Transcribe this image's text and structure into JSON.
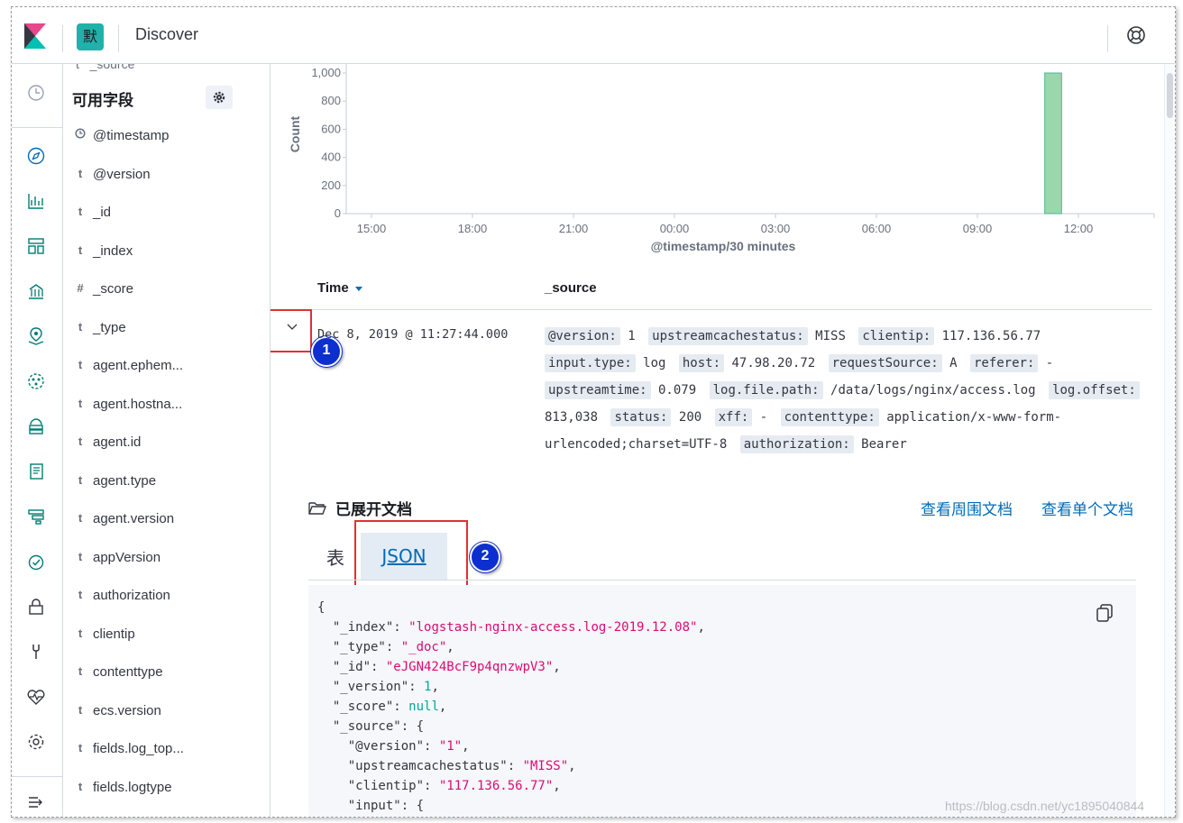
{
  "header": {
    "space_initial": "默",
    "app_title": "Discover"
  },
  "fields": {
    "cut_label": "_source",
    "title": "可用字段",
    "items": [
      {
        "type": "clock",
        "name": "@timestamp"
      },
      {
        "type": "t",
        "name": "@version"
      },
      {
        "type": "t",
        "name": "_id"
      },
      {
        "type": "t",
        "name": "_index"
      },
      {
        "type": "#",
        "name": "_score"
      },
      {
        "type": "t",
        "name": "_type"
      },
      {
        "type": "t",
        "name": "agent.ephem..."
      },
      {
        "type": "t",
        "name": "agent.hostna..."
      },
      {
        "type": "t",
        "name": "agent.id"
      },
      {
        "type": "t",
        "name": "agent.type"
      },
      {
        "type": "t",
        "name": "agent.version"
      },
      {
        "type": "t",
        "name": "appVersion"
      },
      {
        "type": "t",
        "name": "authorization"
      },
      {
        "type": "t",
        "name": "clientip"
      },
      {
        "type": "t",
        "name": "contenttype"
      },
      {
        "type": "t",
        "name": "ecs.version"
      },
      {
        "type": "t",
        "name": "fields.log_top..."
      },
      {
        "type": "t",
        "name": "fields.logtype"
      }
    ]
  },
  "chart_data": {
    "type": "bar",
    "title": "",
    "xlabel": "@timestamp/30 minutes",
    "ylabel": "Count",
    "ylim": [
      0,
      1000
    ],
    "yticks": [
      "0",
      "200",
      "400",
      "600",
      "800",
      "1,000"
    ],
    "xticks": [
      "15:00",
      "18:00",
      "21:00",
      "00:00",
      "03:00",
      "06:00",
      "09:00",
      "12:00"
    ],
    "x_start_hours": 14.25,
    "x_end_hours": 38.25,
    "categories": [
      "11:00"
    ],
    "x_hours": [
      35.0
    ],
    "values": [
      1000
    ],
    "bar_color": "#9ad7aa",
    "bar_border": "#54b399"
  },
  "table": {
    "col_time": "Time",
    "col_source": "_source",
    "row": {
      "time": "Dec 8, 2019 @ 11:27:44.000",
      "fields": [
        {
          "k": "@version:",
          "v": "1"
        },
        {
          "k": "upstreamcachestatus:",
          "v": "MISS"
        },
        {
          "k": "clientip:",
          "v": "117.136.56.77"
        },
        {
          "k": "input.type:",
          "v": "log"
        },
        {
          "k": "host:",
          "v": "47.98.20.72"
        },
        {
          "k": "requestSource:",
          "v": "A"
        },
        {
          "k": "referer:",
          "v": "-"
        },
        {
          "k": "upstreamtime:",
          "v": "0.079"
        },
        {
          "k": "log.file.path:",
          "v": "/data/logs/nginx/access.log"
        },
        {
          "k": "log.offset:",
          "v": "813,038"
        },
        {
          "k": "status:",
          "v": "200"
        },
        {
          "k": "xff:",
          "v": "-"
        },
        {
          "k": "contenttype:",
          "v": "application/x-www-form-urlencoded;charset=UTF-8"
        },
        {
          "k": "authorization:",
          "v": "Bearer"
        }
      ]
    }
  },
  "doc": {
    "title": "已展开文档",
    "link_surrounding": "查看周围文档",
    "link_single": "查看单个文档",
    "tab_table": "表",
    "tab_json": "JSON",
    "json_lines": [
      [
        [
          "p",
          "{"
        ]
      ],
      [
        [
          "p",
          "  \"_index\": "
        ],
        [
          "s",
          "\"logstash-nginx-access.log-2019.12.08\""
        ],
        [
          "p",
          ","
        ]
      ],
      [
        [
          "p",
          "  \"_type\": "
        ],
        [
          "s",
          "\"_doc\""
        ],
        [
          "p",
          ","
        ]
      ],
      [
        [
          "p",
          "  \"_id\": "
        ],
        [
          "s",
          "\"eJGN424BcF9p4qnzwpV3\""
        ],
        [
          "p",
          ","
        ]
      ],
      [
        [
          "p",
          "  \"_version\": "
        ],
        [
          "n",
          "1"
        ],
        [
          "p",
          ","
        ]
      ],
      [
        [
          "p",
          "  \"_score\": "
        ],
        [
          "n",
          "null"
        ],
        [
          "p",
          ","
        ]
      ],
      [
        [
          "p",
          "  \"_source\": {"
        ]
      ],
      [
        [
          "p",
          "    \"@version\": "
        ],
        [
          "s",
          "\"1\""
        ],
        [
          "p",
          ","
        ]
      ],
      [
        [
          "p",
          "    \"upstreamcachestatus\": "
        ],
        [
          "s",
          "\"MISS\""
        ],
        [
          "p",
          ","
        ]
      ],
      [
        [
          "p",
          "    \"clientip\": "
        ],
        [
          "s",
          "\"117.136.56.77\""
        ],
        [
          "p",
          ","
        ]
      ],
      [
        [
          "p",
          "    \"input\": {"
        ]
      ]
    ]
  },
  "annotations": {
    "badge1": "1",
    "badge2": "2"
  },
  "watermark": "https://blog.csdn.net/yc1895040844"
}
